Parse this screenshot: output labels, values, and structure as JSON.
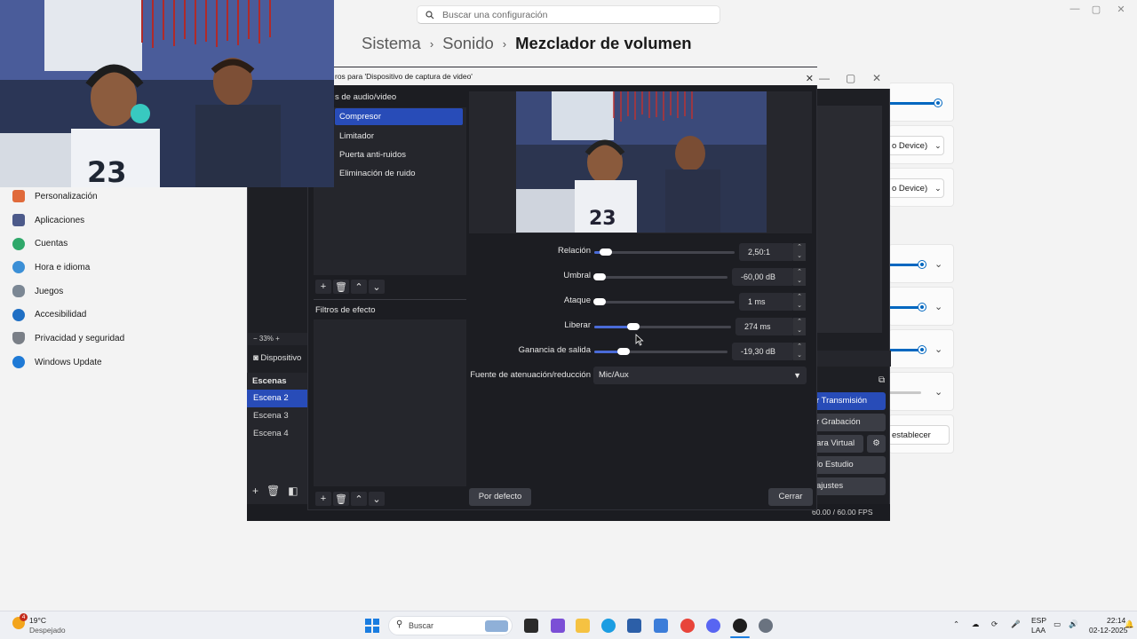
{
  "settings": {
    "search": {
      "placeholder": "Buscar una configuración"
    },
    "breadcrumb": {
      "level1": "Sistema",
      "level2": "Sonido",
      "current": "Mezclador de volumen"
    },
    "nav": [
      {
        "label": "Personalización",
        "icon": "brush-icon",
        "color": "#e06a3b"
      },
      {
        "label": "Aplicaciones",
        "icon": "apps-icon",
        "color": "#4c5a8a"
      },
      {
        "label": "Cuentas",
        "icon": "person-icon",
        "color": "#2fa86a"
      },
      {
        "label": "Hora e idioma",
        "icon": "globe-clock-icon",
        "color": "#3b8fd6"
      },
      {
        "label": "Juegos",
        "icon": "gamepad-icon",
        "color": "#7b8794"
      },
      {
        "label": "Accesibilidad",
        "icon": "accessibility-icon",
        "color": "#1f6fc4"
      },
      {
        "label": "Privacidad y seguridad",
        "icon": "shield-icon",
        "color": "#7a7f87"
      },
      {
        "label": "Windows Update",
        "icon": "update-icon",
        "color": "#1f7ad6"
      }
    ],
    "device_dropdown_1": "o Device)",
    "device_dropdown_2": "o Device)",
    "reset_label": "establecer"
  },
  "obs": {
    "zoom_label": "33%",
    "source_label": "Dispositivo",
    "scenes": {
      "title": "Escenas",
      "items": [
        "Escena 2",
        "Escena 3",
        "Escena 4"
      ],
      "active_index": 0
    },
    "controls": [
      {
        "label": "r Transmisión"
      },
      {
        "label": "r Grabación"
      },
      {
        "label": "ara Virtual"
      },
      {
        "label": "lo Estudio"
      },
      {
        "label": "ajustes"
      }
    ],
    "fps": "60.00 / 60.00 FPS"
  },
  "dialog": {
    "title": "ros para 'Dispositivo de captura de video'",
    "audio_section": "s de audio/video",
    "filters": [
      "Compresor",
      "Limitador",
      "Puerta anti-ruidos",
      "Eliminación de ruido"
    ],
    "active_filter_index": 0,
    "effect_section": "Filtros de efecto",
    "params": [
      {
        "label": "Relación",
        "value": "2,50:1",
        "level": 0.08
      },
      {
        "label": "Umbral",
        "value": "-60,00 dB",
        "level": 0.0
      },
      {
        "label": "Ataque",
        "value": "1 ms",
        "level": 0.0
      },
      {
        "label": "Liberar",
        "value": "274 ms",
        "level": 0.29
      },
      {
        "label": "Ganancia de salida",
        "value": "-19,30 dB",
        "level": 0.22
      }
    ],
    "sidechain_label": "Fuente de atenuación/reducción",
    "sidechain_value": "Mic/Aux",
    "default_button": "Por defecto",
    "close_button": "Cerrar"
  },
  "taskbar": {
    "weather": {
      "temp": "19°C",
      "condition": "Despejado",
      "badge": "4"
    },
    "search_label": "Buscar",
    "lang_line1": "ESP",
    "lang_line2": "LAA",
    "time": "22:14",
    "date": "02-12-2025"
  },
  "colors": {
    "accent_blue": "#284cb8",
    "win_accent": "#0067c0",
    "obs_bg": "#1e1f24"
  }
}
